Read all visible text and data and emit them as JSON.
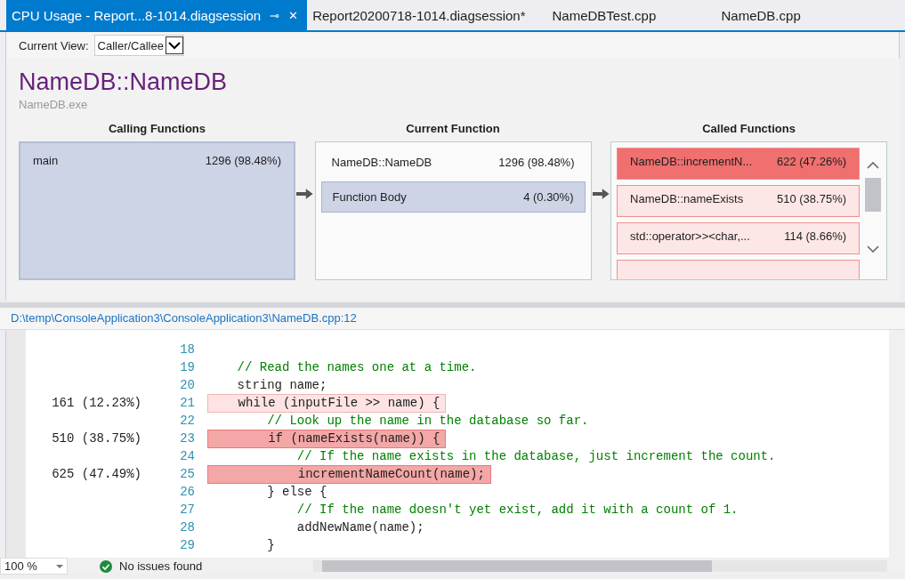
{
  "tabs": [
    {
      "label": "CPU Usage - Report...8-1014.diagsession",
      "selected": true,
      "pin": "⊸",
      "close": "✕"
    },
    {
      "label": "Report20200718-1014.diagsession*",
      "selected": false
    },
    {
      "label": "NameDBTest.cpp",
      "selected": false
    },
    {
      "label": "NameDB.cpp",
      "selected": false
    }
  ],
  "toolbar": {
    "label": "Current View:",
    "view": "Caller/Callee"
  },
  "function": {
    "title": "NameDB::NameDB",
    "module": "NameDB.exe"
  },
  "calling": {
    "heading": "Calling Functions",
    "items": [
      {
        "name": "main",
        "value": "1296 (98.48%)"
      }
    ]
  },
  "current": {
    "heading": "Current Function",
    "name": "NameDB::NameDB",
    "value": "1296 (98.48%)",
    "body": {
      "name": "Function Body",
      "value": "4 (0.30%)"
    }
  },
  "called": {
    "heading": "Called Functions",
    "items": [
      {
        "name": "NameDB::incrementN...",
        "value": "622 (47.26%)",
        "hot": true
      },
      {
        "name": "NameDB::nameExists",
        "value": "510 (38.75%)",
        "hot": false
      },
      {
        "name": "std::operator>><char,...",
        "value": "114 (8.66%)",
        "hot": false
      }
    ]
  },
  "path": "D:\\temp\\ConsoleApplication3\\ConsoleApplication3\\NameDB.cpp:12",
  "code": [
    {
      "number": "18"
    },
    {
      "number": "19",
      "text": "    // Read the names one at a time.",
      "kind": "comment"
    },
    {
      "number": "20",
      "text": "    string name;",
      "kind": "code"
    },
    {
      "number": "21",
      "text": "    while (inputFile >> name) {",
      "kind": "keyword",
      "sample": "161 (12.23%)",
      "hot": false
    },
    {
      "number": "22",
      "text": "        // Look up the name in the database so far.",
      "kind": "comment"
    },
    {
      "number": "23",
      "text": "        if (nameExists(name)) {",
      "kind": "keyword",
      "sample": "510 (38.75%)",
      "hot": true
    },
    {
      "number": "24",
      "text": "            // If the name exists in the database, just increment the count.",
      "kind": "comment"
    },
    {
      "number": "25",
      "text": "            incrementNameCount(name);",
      "kind": "code",
      "sample": "625 (47.49%)",
      "hot": true
    },
    {
      "number": "26",
      "text": "        } else {",
      "kind": "keyword"
    },
    {
      "number": "27",
      "text": "            // If the name doesn't yet exist, add it with a count of 1.",
      "kind": "comment"
    },
    {
      "number": "28",
      "text": "            addNewName(name);",
      "kind": "code"
    },
    {
      "number": "29",
      "text": "        }",
      "kind": "code"
    }
  ],
  "status": {
    "zoom": "100 %",
    "issues": "No issues found"
  }
}
